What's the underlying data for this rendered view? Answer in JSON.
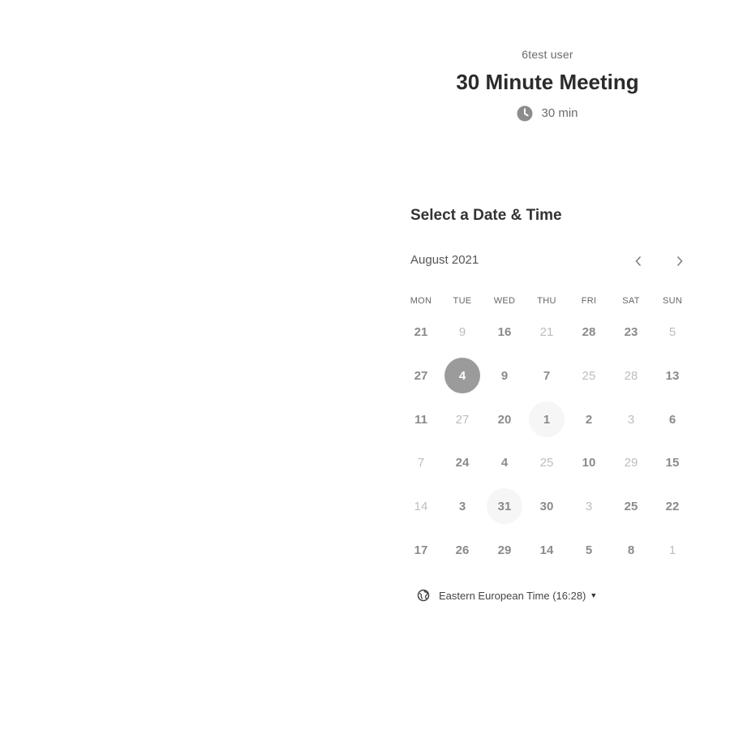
{
  "header": {
    "host_name": "6test user",
    "event_title": "30 Minute Meeting",
    "duration": "30 min",
    "duration_icon": "clock-icon"
  },
  "calendar": {
    "heading": "Select a Date & Time",
    "month_label": "August 2021",
    "prev_icon": "chevron-left-icon",
    "next_icon": "chevron-right-icon",
    "weekdays": [
      "MON",
      "TUE",
      "WED",
      "THU",
      "FRI",
      "SAT",
      "SUN"
    ],
    "weeks": [
      [
        {
          "label": "21",
          "available": true
        },
        {
          "label": "9",
          "available": false
        },
        {
          "label": "16",
          "available": true
        },
        {
          "label": "21",
          "available": false
        },
        {
          "label": "28",
          "available": true
        },
        {
          "label": "23",
          "available": true
        },
        {
          "label": "5",
          "available": false
        }
      ],
      [
        {
          "label": "27",
          "available": true
        },
        {
          "label": "4",
          "available": true,
          "selected": true
        },
        {
          "label": "9",
          "available": true
        },
        {
          "label": "7",
          "available": true
        },
        {
          "label": "25",
          "available": false
        },
        {
          "label": "28",
          "available": false
        },
        {
          "label": "13",
          "available": true
        }
      ],
      [
        {
          "label": "11",
          "available": true
        },
        {
          "label": "27",
          "available": false
        },
        {
          "label": "20",
          "available": true
        },
        {
          "label": "1",
          "available": true,
          "today": true
        },
        {
          "label": "2",
          "available": true
        },
        {
          "label": "3",
          "available": false
        },
        {
          "label": "6",
          "available": true
        }
      ],
      [
        {
          "label": "7",
          "available": false
        },
        {
          "label": "24",
          "available": true
        },
        {
          "label": "4",
          "available": true
        },
        {
          "label": "25",
          "available": false
        },
        {
          "label": "10",
          "available": true
        },
        {
          "label": "29",
          "available": false
        },
        {
          "label": "15",
          "available": true
        }
      ],
      [
        {
          "label": "14",
          "available": false
        },
        {
          "label": "3",
          "available": true
        },
        {
          "label": "31",
          "available": true,
          "today": true
        },
        {
          "label": "30",
          "available": true
        },
        {
          "label": "3",
          "available": false
        },
        {
          "label": "25",
          "available": true
        },
        {
          "label": "22",
          "available": true
        }
      ],
      [
        {
          "label": "17",
          "available": true
        },
        {
          "label": "26",
          "available": true
        },
        {
          "label": "29",
          "available": true
        },
        {
          "label": "14",
          "available": true
        },
        {
          "label": "5",
          "available": true
        },
        {
          "label": "8",
          "available": true
        },
        {
          "label": "1",
          "available": false
        }
      ]
    ]
  },
  "timezone": {
    "label": "Eastern European Time (16:28)",
    "icon": "globe-icon",
    "dropdown_icon": "caret-down-icon"
  },
  "colors": {
    "selected_bg": "#9b9b9b",
    "available_text": "#8a8a8a",
    "unavailable_text": "#bdbdbd"
  }
}
